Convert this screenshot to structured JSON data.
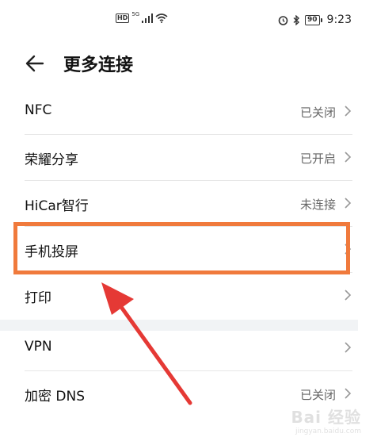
{
  "status_bar": {
    "signal_label": "5G",
    "battery": "90",
    "time": "9:23"
  },
  "header": {
    "title": "更多连接"
  },
  "items": [
    {
      "label": "NFC",
      "value": "已关闭"
    },
    {
      "label": "荣耀分享",
      "value": "已开启"
    },
    {
      "label": "HiCar智行",
      "value": "未连接"
    },
    {
      "label": "手机投屏",
      "value": ""
    },
    {
      "label": "打印",
      "value": ""
    },
    {
      "label": "VPN",
      "value": ""
    },
    {
      "label": "加密 DNS",
      "value": "已关闭"
    }
  ],
  "annotation": {
    "highlight_color": "#f07a3c",
    "arrow_color": "#e53935"
  },
  "watermark": {
    "main": "Bai 经验",
    "sub": "jingyan.baidu.com"
  }
}
